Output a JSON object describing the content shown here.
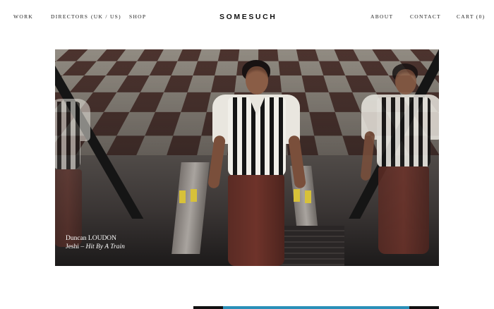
{
  "nav": {
    "work": "WORK",
    "directors": "DIRECTORS",
    "region": "(UK / US)",
    "shop": "SHOP",
    "logo": "SOMESUCH",
    "about": "ABOUT",
    "contact": "CONTACT",
    "cart": "CART (0)"
  },
  "hero": {
    "director_first": "Duncan",
    "director_last": "LOUDON",
    "artist": "Jeshi",
    "separator": "–",
    "title": "Hit By A Train"
  }
}
